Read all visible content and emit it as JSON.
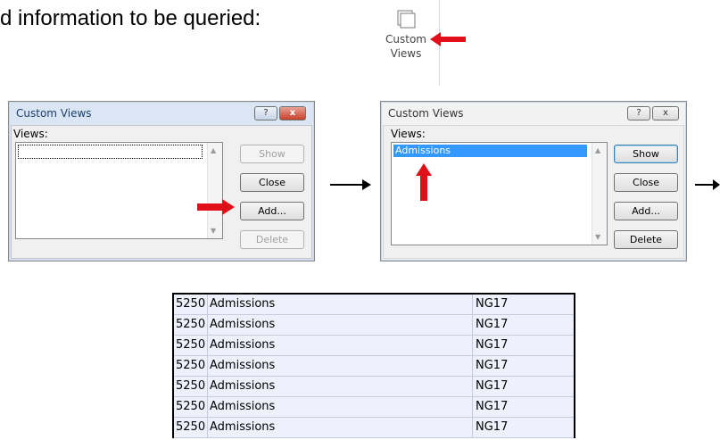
{
  "heading": "d information to be queried:",
  "ribbon": {
    "button_label_line1": "Custom",
    "button_label_line2": "Views",
    "icon": "custom-views-icon"
  },
  "dialog1": {
    "title": "Custom Views",
    "views_label": "Views:",
    "items": [
      ""
    ],
    "buttons": {
      "show": "Show",
      "close": "Close",
      "add": "Add...",
      "delete": "Delete"
    },
    "help": "?",
    "close_x": "x"
  },
  "dialog2": {
    "title": "Custom Views",
    "views_label": "Views:",
    "items": [
      "Admissions"
    ],
    "buttons": {
      "show": "Show",
      "close": "Close",
      "add": "Add...",
      "delete": "Delete"
    },
    "help": "?",
    "close_x": "x"
  },
  "table": {
    "rows": [
      {
        "code": "5250",
        "name": "Admissions",
        "grade": "NG17"
      },
      {
        "code": "5250",
        "name": "Admissions",
        "grade": "NG17"
      },
      {
        "code": "5250",
        "name": "Admissions",
        "grade": "NG17"
      },
      {
        "code": "5250",
        "name": "Admissions",
        "grade": "NG17"
      },
      {
        "code": "5250",
        "name": "Admissions",
        "grade": "NG17"
      },
      {
        "code": "5250",
        "name": "Admissions",
        "grade": "NG17"
      },
      {
        "code": "5250",
        "name": "Admissions",
        "grade": "NG17"
      }
    ]
  },
  "colors": {
    "arrow_red": "#e0101a",
    "selection": "#3399ff",
    "table_bg": "#eef0fb"
  }
}
